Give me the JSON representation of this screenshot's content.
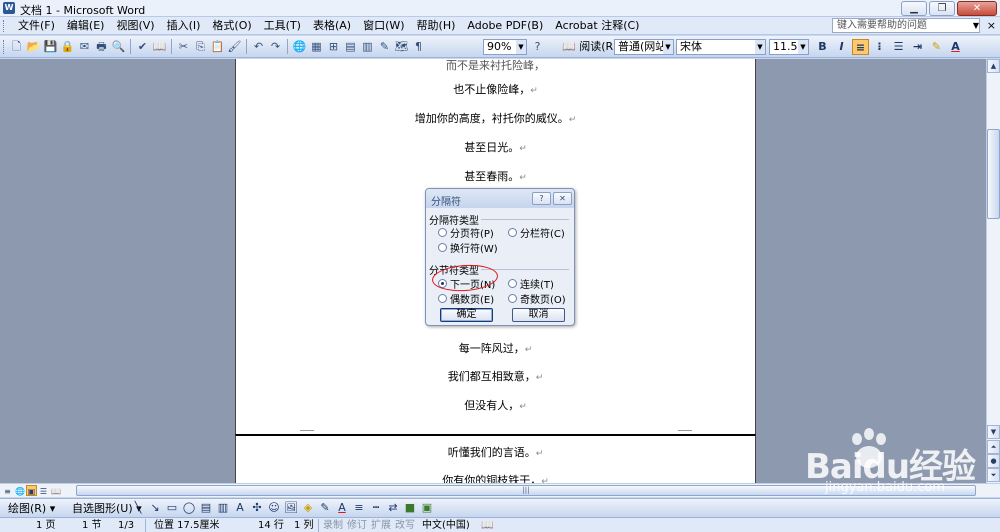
{
  "window": {
    "title": "文档 1 - Microsoft Word",
    "icon": "W",
    "minimize": "▁",
    "restore": "❐",
    "close": "✕"
  },
  "menubar": {
    "items": [
      "文件(F)",
      "编辑(E)",
      "视图(V)",
      "插入(I)",
      "格式(O)",
      "工具(T)",
      "表格(A)",
      "窗口(W)",
      "帮助(H)",
      "Adobe PDF(B)",
      "Acrobat 注释(C)"
    ],
    "help_placeholder": "键入需要帮助的问题",
    "close_glyph": "×"
  },
  "toolbar": {
    "zoom": "90%",
    "read_label": "阅读(R)",
    "style": "普通(网站)",
    "font": "宋体",
    "size": "11.5",
    "bold": "B",
    "italic": "I",
    "underline": "U"
  },
  "document": {
    "lines": [
      "也不止像险峰，",
      "增加你的高度，衬托你的威仪。",
      "甚至日光。",
      "甚至春雨。",
      "每一阵风过，",
      "我们都互相致意，",
      "但没有人，"
    ],
    "partial_top": "而不是来衬托险峰，",
    "page2_lines": [
      "听懂我们的言语。",
      "你有你的铜枝铁干，"
    ],
    "pilcrow": "↵"
  },
  "dialog": {
    "title": "分隔符",
    "help_glyph": "?",
    "close_glyph": "✕",
    "group1_label": "分隔符类型",
    "group1_options": {
      "page": "分页符(P)",
      "column": "分栏符(C)",
      "text_wrap": "换行符(W)"
    },
    "group2_label": "分节符类型",
    "group2_options": {
      "next_page": "下一页(N)",
      "continuous": "连续(T)",
      "even_page": "偶数页(E)",
      "odd_page": "奇数页(O)"
    },
    "selected": "next_page",
    "ok": "确定",
    "cancel": "取消"
  },
  "drawbar": {
    "draw_label": "绘图(R) ▾",
    "autoshape_label": "自选图形(U) ▾"
  },
  "status": {
    "page": "1 页",
    "section": "1 节",
    "page_of": "1/3",
    "position": "位置 17.5厘米",
    "line": "14 行",
    "col": "1 列",
    "rec": "录制",
    "trk": "修订",
    "ext": "扩展",
    "ovr": "改写",
    "lang": "中文(中国)"
  },
  "watermark": {
    "brand": "Baidu经验",
    "url": "jingyan.baidu.com"
  },
  "colors": {
    "titlebar": "#eaf1fb",
    "workspace": "#8d99ae",
    "highlight": "#ffc96b",
    "annotation": "#e01818"
  }
}
